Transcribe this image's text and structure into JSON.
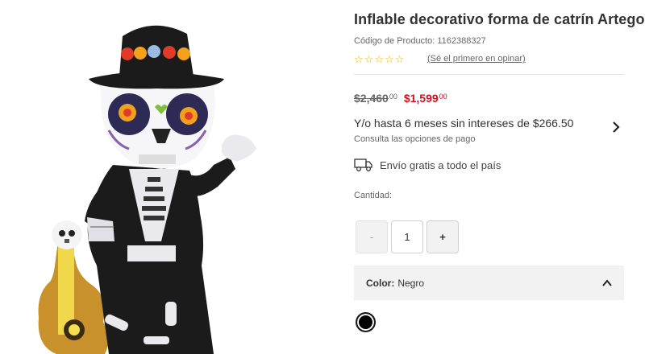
{
  "product": {
    "title": "Inflable decorativo forma de catrín Artego",
    "sku_label": "Código de Producto:",
    "sku_value": "1162388327",
    "rating_stars": 0,
    "rating_max": 5,
    "review_link": "(Sé el primero en opinar)",
    "image_icon": "catrin-inflatable-image"
  },
  "pricing": {
    "old_price": "$2,460",
    "old_cents": "00",
    "new_price": "$1,599",
    "new_cents": "00",
    "installments": "Y/o hasta 6 meses sin intereses de $266.50",
    "payment_options": "Consulta las opciones de pago"
  },
  "shipping": {
    "text": "Envío gratis a todo el país",
    "icon": "truck-icon"
  },
  "quantity": {
    "label": "Cantidad:",
    "minus": "-",
    "value": "1",
    "plus": "+"
  },
  "color": {
    "label": "Color:",
    "value": "Negro",
    "swatches": [
      {
        "name": "Negro",
        "hex": "#000000",
        "selected": true
      }
    ]
  },
  "colors": {
    "sale_red": "#e00f1b",
    "star_gold": "#f5b400",
    "panel_gray": "#f2f2f2"
  }
}
